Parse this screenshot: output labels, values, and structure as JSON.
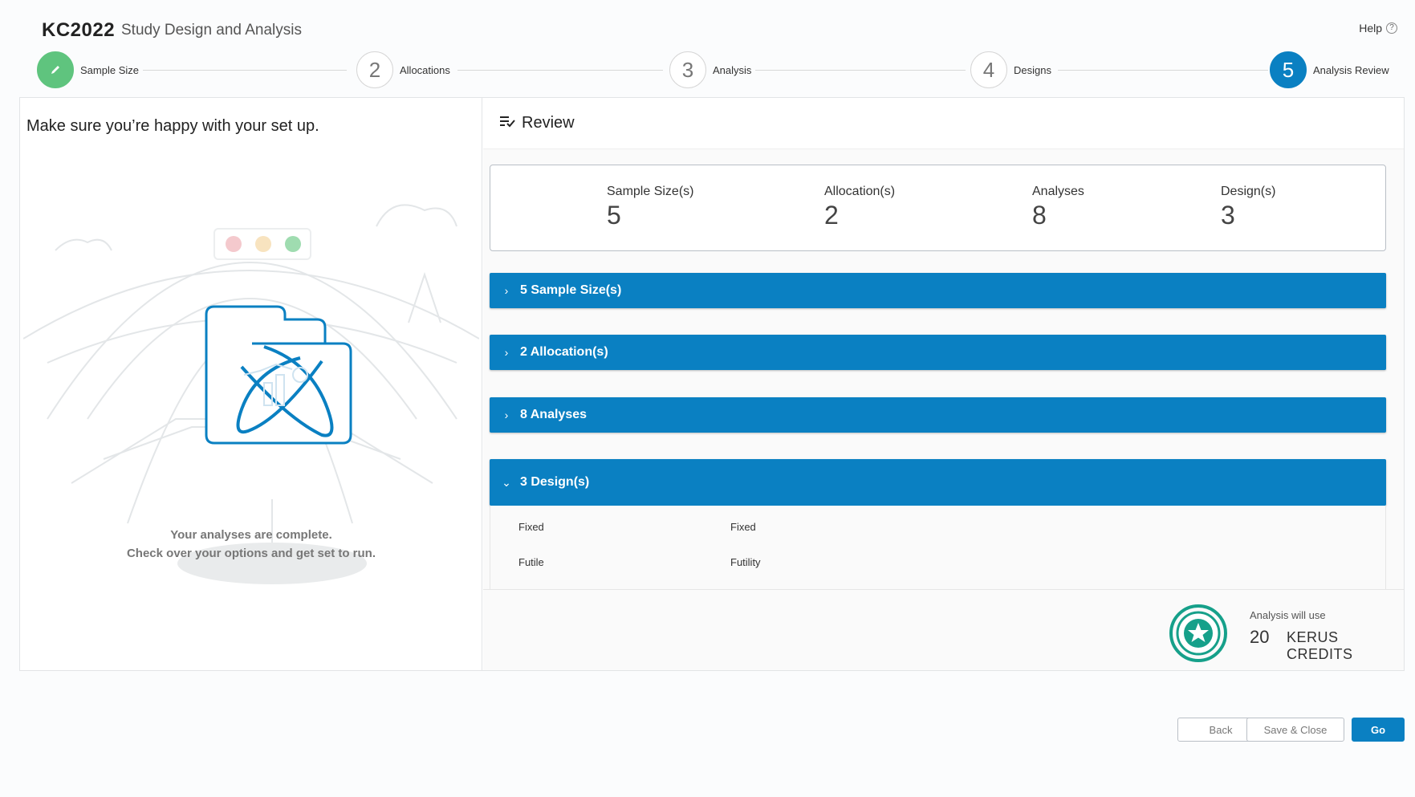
{
  "header": {
    "brand": "KC2022",
    "subtitle": "Study Design and Analysis",
    "help_label": "Help",
    "help_icon": "?"
  },
  "stepper": {
    "steps": [
      {
        "number": "",
        "label": "Sample Size",
        "state": "done",
        "icon": "pencil-icon"
      },
      {
        "number": "2",
        "label": "Allocations",
        "state": "pending"
      },
      {
        "number": "3",
        "label": "Analysis",
        "state": "pending"
      },
      {
        "number": "4",
        "label": "Designs",
        "state": "pending"
      },
      {
        "number": "5",
        "label": "Analysis Review",
        "state": "active"
      }
    ]
  },
  "left_panel": {
    "title": "Make sure you’re happy with your set up.",
    "complete_line1": "Your analyses are complete.",
    "complete_line2": "Check over your options and get set to run."
  },
  "review": {
    "title": "Review",
    "icon": "checklist-icon",
    "summary": [
      {
        "label": "Sample Size(s)",
        "value": "5"
      },
      {
        "label": "Allocation(s)",
        "value": "2"
      },
      {
        "label": "Analyses",
        "value": "8"
      },
      {
        "label": "Design(s)",
        "value": "3"
      }
    ],
    "sections": [
      {
        "label": "5 Sample Size(s)",
        "expanded": false,
        "chevron": "›"
      },
      {
        "label": "2 Allocation(s)",
        "expanded": false,
        "chevron": "›"
      },
      {
        "label": "8 Analyses",
        "expanded": false,
        "chevron": "›"
      },
      {
        "label": "3 Design(s)",
        "expanded": true,
        "chevron": "⌄"
      }
    ],
    "design_rows": [
      {
        "name": "Fixed",
        "value": "Fixed"
      },
      {
        "name": "Futile",
        "value": "Futility"
      }
    ]
  },
  "credits": {
    "label": "Analysis will use",
    "value": "20",
    "unit": "KERUS CREDITS"
  },
  "footer": {
    "back_label": "Back",
    "save_close_label": "Save & Close",
    "go_label": "Go"
  },
  "colors": {
    "primary": "#0a80c2",
    "done_green": "#5fc47e",
    "credit_teal": "#16a08a"
  }
}
